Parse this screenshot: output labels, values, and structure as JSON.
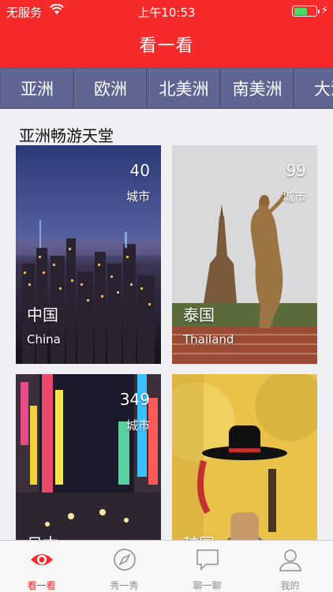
{
  "status": {
    "carrier": "无服务",
    "time": "上午10:53"
  },
  "header": {
    "title": "看一看"
  },
  "continents": [
    "亚洲",
    "欧洲",
    "北美洲",
    "南美洲",
    "大洋"
  ],
  "section": {
    "title": "亚洲畅游天堂"
  },
  "cards": [
    {
      "count": "40",
      "unit": "城市",
      "name_cn": "中国",
      "name_en": "China"
    },
    {
      "count": "99",
      "unit": "城市",
      "name_cn": "泰国",
      "name_en": "Thailand"
    },
    {
      "count": "349",
      "unit": "城市",
      "name_cn": "日本",
      "name_en": ""
    },
    {
      "count": "",
      "unit": "",
      "name_cn": "韩国",
      "name_en": ""
    }
  ],
  "tabbar": {
    "items": [
      "看一看",
      "秀一秀",
      "聊一聊",
      "我的"
    ],
    "active_color": "#f62a2a"
  },
  "colors": {
    "header": "#f62a2a",
    "tabs": "#5a5f87"
  }
}
